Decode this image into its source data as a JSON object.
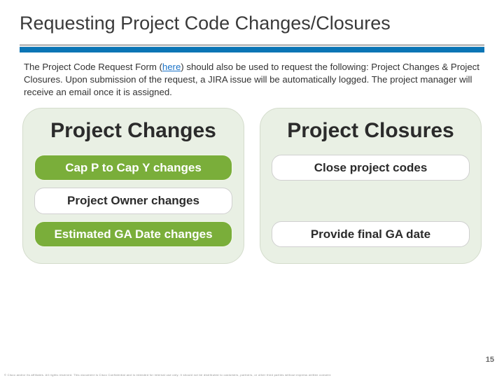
{
  "title": "Requesting Project Code Changes/Closures",
  "intro_pre": "The Project Code Request Form (",
  "intro_link": "here",
  "intro_post": ") should also be used to request the following: Project Changes & Project Closures. Upon submission of the request, a JIRA issue will be automatically logged.  The project manager will receive an email once it is assigned.",
  "columns": {
    "changes": {
      "heading": "Project Changes",
      "items": [
        {
          "text": "Cap P to Cap Y changes",
          "style": "green"
        },
        {
          "text": "Project Owner changes",
          "style": "white"
        },
        {
          "text": "Estimated GA Date changes",
          "style": "green"
        }
      ]
    },
    "closures": {
      "heading": "Project Closures",
      "items": [
        {
          "text": "Close project codes",
          "style": "white"
        },
        {
          "text": "Provide final GA date",
          "style": "white"
        }
      ]
    }
  },
  "page_number": "15",
  "footer": "© Cisco and/or its affiliates. All rights reserved. This document is Cisco Confidential and is intended for internal use only. It should not be distributed to customers, partners, or other third parties without express written consent."
}
